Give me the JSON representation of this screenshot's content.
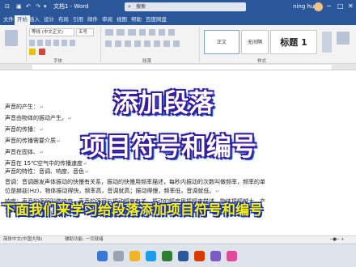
{
  "titlebar": {
    "doc_title": "文档1 - Word",
    "search_placeholder": "搜索",
    "user_name": "ning hu"
  },
  "menu": {
    "tabs": [
      "文件",
      "开始",
      "插入",
      "设计",
      "布局",
      "引用",
      "邮件",
      "审阅",
      "视图",
      "帮助",
      "百度网盘"
    ],
    "active_index": 1
  },
  "ribbon": {
    "font_name": "等线 (中文正文)",
    "font_size": "五号",
    "group_font": "字体",
    "group_paragraph": "段落",
    "group_styles": "样式",
    "style_1": "正文",
    "style_2": "无间隔",
    "style_3": "标题 1"
  },
  "document": {
    "lines": [
      "声音的产生：",
      "声音由物体的振动产生。",
      "声音的传播：",
      "声音的传播需要介质",
      "声音在固体、",
      "声音在 15℃空气中的传播速度",
      "声音的特性：音调、响度、音色",
      "音调：音调跟发声体振动的快慢有关系，振动的快慢用频率描述，每秒内振动的次数叫做频率，频率的单",
      "位是赫兹(Hz)，物体振动得快，频率高，音调就高；振动得慢，频率低，音调就低。",
      "响度：声音的强弱叫做响度，声音的强弱与振动幅度有关，振动的幅度用振幅来描述，物体振幅越大，产",
      "生声音的响度越大，物体振幅越小，产生的响度越小。"
    ],
    "paragraph_mark": "↵"
  },
  "overlay": {
    "title_line_1": "添加段落",
    "title_line_2": "项目符号和编号",
    "subtitle": "下面我们来学习给段落添加项目符号和编号"
  },
  "statusbar": {
    "language": "简体中文(中国大陆)",
    "accessibility": "辅助功能: 一切就绪"
  },
  "colors": {
    "word_blue": "#2b579a",
    "title_text": "#ffffff",
    "title_outline": "#3a1a9c",
    "subtitle_text": "#fff200",
    "subtitle_outline": "#1530b8"
  }
}
